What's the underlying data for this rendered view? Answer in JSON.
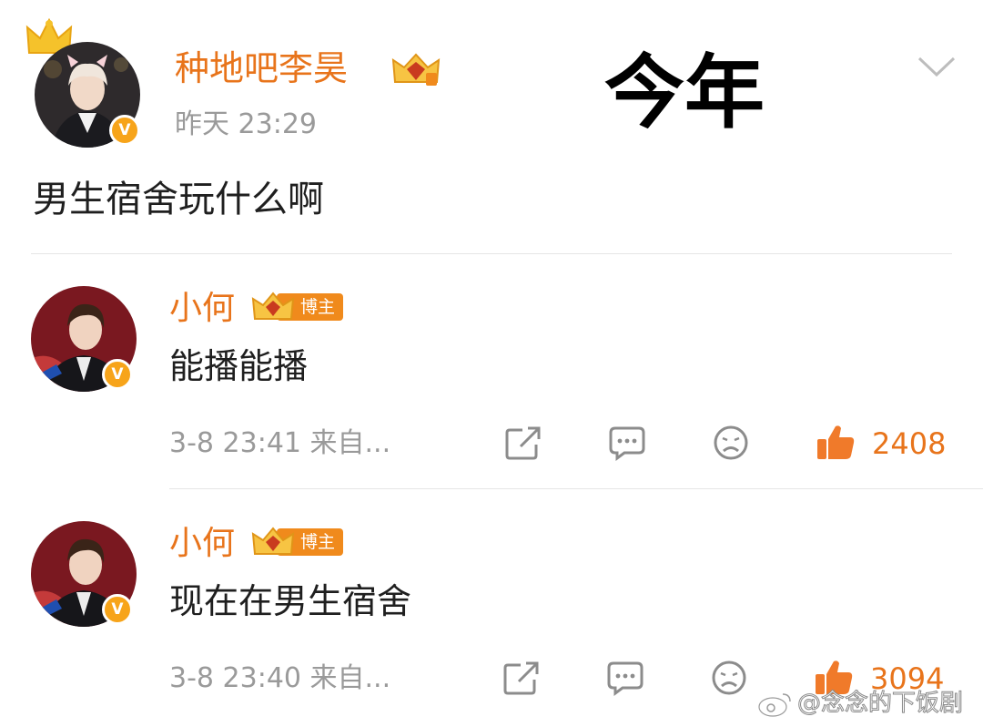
{
  "post": {
    "author": "种地吧李昊",
    "time": "昨天 23:29",
    "content": "男生宿舍玩什么啊"
  },
  "overlay_text": "今年",
  "comments": [
    {
      "author": "小何",
      "badge": "博主",
      "content": "能播能播",
      "meta": "3-8 23:41 来自...",
      "likes": "2408"
    },
    {
      "author": "小何",
      "badge": "博主",
      "content": "现在在男生宿舍",
      "meta": "3-8 23:40 来自...",
      "likes": "3094"
    }
  ],
  "watermark": "@念念的下饭剧",
  "colors": {
    "accent": "#e8741b",
    "muted": "#9a9a9a",
    "badge": "#f08a1c"
  },
  "icons": [
    "crown-icon",
    "verified-v-icon",
    "chevron-down-icon",
    "share-icon",
    "comment-icon",
    "dislike-face-icon",
    "thumbs-up-icon",
    "weibo-logo-icon"
  ]
}
